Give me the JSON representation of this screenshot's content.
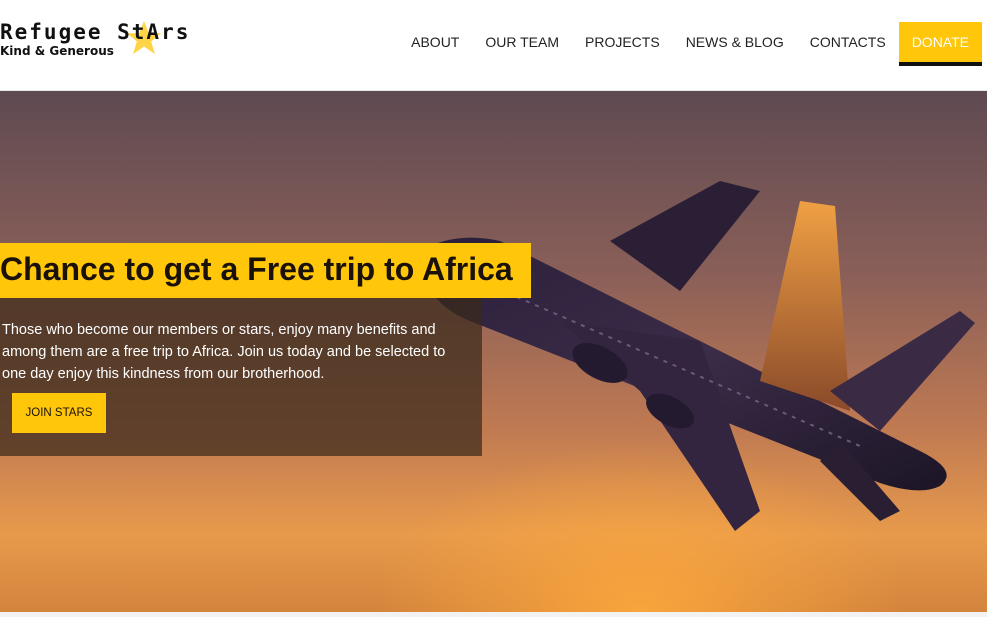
{
  "brand": {
    "title": "Refugee StArs",
    "tagline": "Kind & Generous",
    "accent": "#ffc60a"
  },
  "nav": {
    "items": [
      {
        "label": "ABOUT"
      },
      {
        "label": "OUR TEAM"
      },
      {
        "label": "PROJECTS"
      },
      {
        "label": "NEWS & BLOG"
      },
      {
        "label": "CONTACTS"
      }
    ],
    "donate_label": "DONATE"
  },
  "hero": {
    "headline": "Chance to get a Free trip to Africa",
    "description": "Those who become our members or stars, enjoy many benefits and among them are a free trip to Africa. Join us today and be selected to one day enjoy this kindness from our brotherhood.",
    "cta_label": "JOIN STARS",
    "image": "airplane-takeoff-sunset"
  }
}
